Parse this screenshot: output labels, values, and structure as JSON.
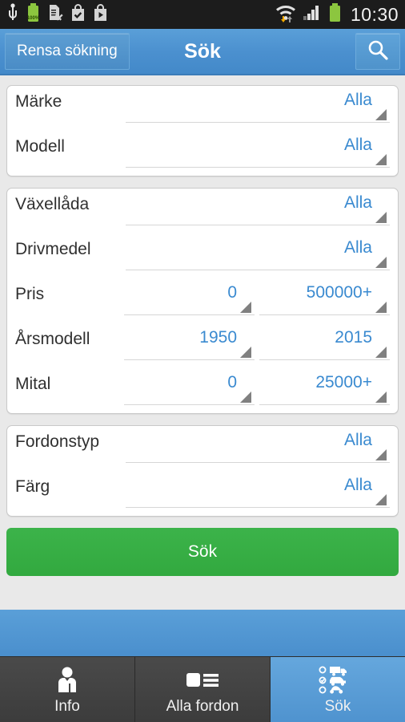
{
  "statusbar": {
    "time": "10:30",
    "battery_label": "100%",
    "icons_left": [
      "usb-icon",
      "battery-charging-icon",
      "sd-card-removed-icon",
      "play-store-check-icon",
      "play-store-play-icon"
    ],
    "icons_right": [
      "wifi-transfer-icon",
      "cellular-signal-icon",
      "battery-icon"
    ]
  },
  "actionbar": {
    "clear_label": "Rensa sökning",
    "title": "Sök",
    "search_icon": "search-icon",
    "accent_color": "#4b90cf"
  },
  "cards": [
    {
      "rows": [
        {
          "label": "Märke",
          "type": "single",
          "values": [
            "Alla"
          ]
        },
        {
          "label": "Modell",
          "type": "single",
          "values": [
            "Alla"
          ]
        }
      ]
    },
    {
      "rows": [
        {
          "label": "Växellåda",
          "type": "single",
          "values": [
            "Alla"
          ]
        },
        {
          "label": "Drivmedel",
          "type": "single",
          "values": [
            "Alla"
          ]
        },
        {
          "label": "Pris",
          "type": "range",
          "values": [
            "0",
            "500000+"
          ]
        },
        {
          "label": "Årsmodell",
          "type": "range",
          "values": [
            "1950",
            "2015"
          ]
        },
        {
          "label": "Mital",
          "type": "range",
          "values": [
            "0",
            "25000+"
          ]
        }
      ]
    },
    {
      "rows": [
        {
          "label": "Fordonstyp",
          "type": "single",
          "values": [
            "Alla"
          ]
        },
        {
          "label": "Färg",
          "type": "single",
          "values": [
            "Alla"
          ]
        }
      ]
    }
  ],
  "submit": {
    "label": "Sök",
    "color": "#34ab41"
  },
  "tabs": [
    {
      "label": "Info",
      "icon": "person-info-icon",
      "active": false
    },
    {
      "label": "Alla fordon",
      "icon": "vehicle-list-icon",
      "active": false
    },
    {
      "label": "Sök",
      "icon": "vehicle-search-icon",
      "active": true
    }
  ],
  "value_color": "#3a8ad0"
}
